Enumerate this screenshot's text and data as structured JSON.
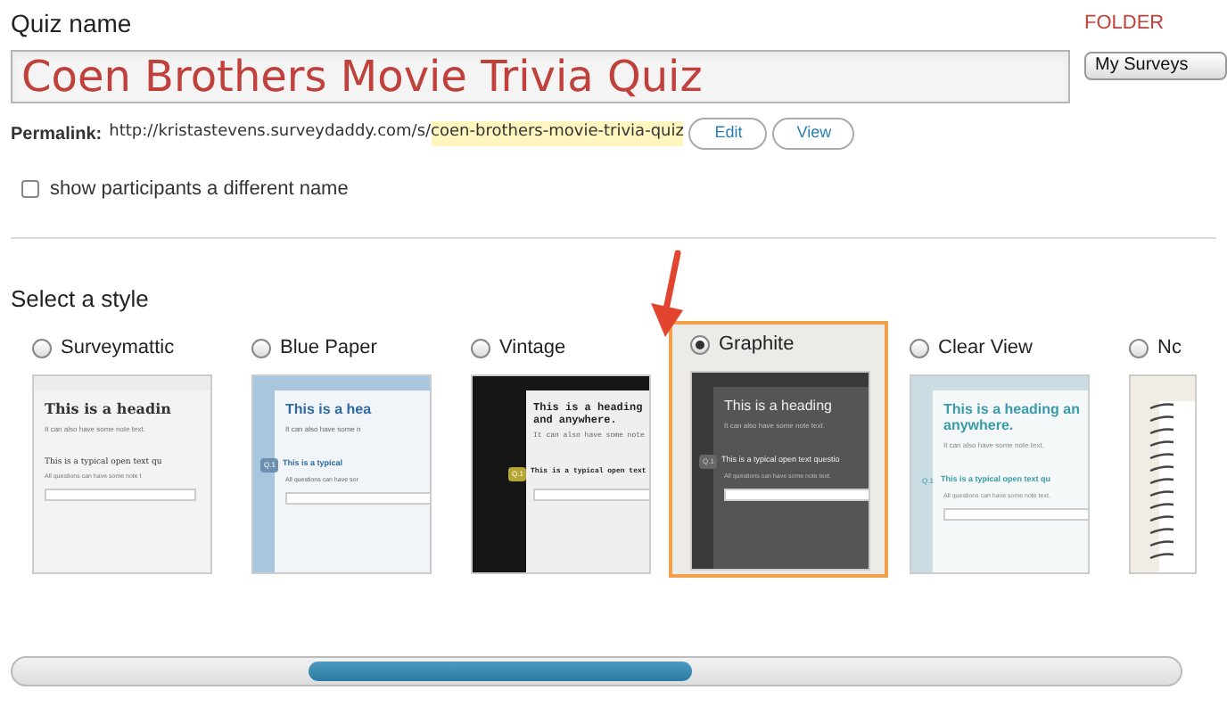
{
  "quiz_name": {
    "label": "Quiz name",
    "value": "Coen Brothers Movie Trivia Quiz"
  },
  "folder": {
    "label": "FOLDER",
    "value": "My Surveys"
  },
  "permalink": {
    "label": "Permalink:",
    "base": "http://kristastevens.surveydaddy.com/s/",
    "slug": "coen-brothers-movie-trivia-quiz",
    "buttons": [
      "Edit",
      "View"
    ]
  },
  "alias_option": {
    "label": "show participants a different name",
    "checked": false
  },
  "style_section": {
    "title": "Select a style"
  },
  "styles": [
    {
      "name": "Surveymattic",
      "selected": false,
      "preview": {
        "kind": "serif_light",
        "heading": "This is a headin",
        "note": "It can also have some note text.",
        "question": "This is a typical open text qu",
        "question_note": "All questions can have some note t"
      }
    },
    {
      "name": "Blue Paper",
      "selected": false,
      "preview": {
        "kind": "blue_paper",
        "heading": "This is a hea",
        "note": "It can also have some n",
        "q_label": "Q.1",
        "question": "This is a typical",
        "question_note": "All questions can have sor"
      }
    },
    {
      "name": "Vintage",
      "selected": false,
      "preview": {
        "kind": "vintage",
        "heading": "This is a heading and anywhere.",
        "note": "It can also have some note",
        "q_label": "Q.1",
        "question": "This is a typical open text"
      }
    },
    {
      "name": "Graphite",
      "selected": true,
      "preview": {
        "kind": "graphite",
        "heading": "This is a heading",
        "note": "It can also have some note text.",
        "q_label": "Q.1",
        "question": "This is a typical open text questio",
        "question_note": "All questions can have some note text."
      }
    },
    {
      "name": "Clear View",
      "selected": false,
      "preview": {
        "kind": "clear_view",
        "heading": "This is a heading an anywhere.",
        "note": "It can also have some note text.",
        "q_label": "Q.1",
        "question": "This is a typical open text qu",
        "question_note": "All questions can have some note text."
      }
    },
    {
      "name": "Nc",
      "selected": false,
      "preview": {
        "kind": "notebook"
      }
    }
  ]
}
